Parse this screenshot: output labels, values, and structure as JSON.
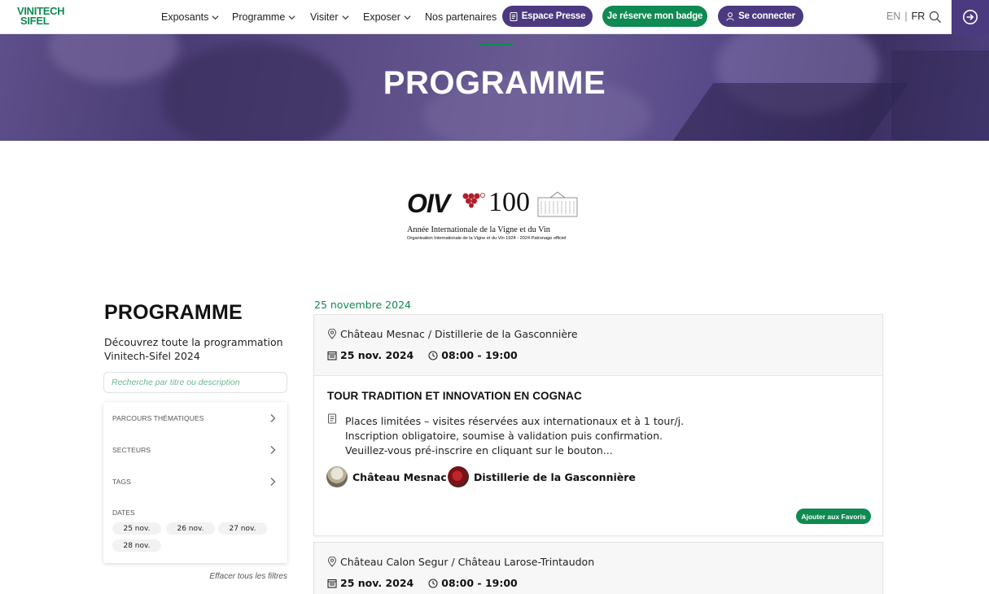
{
  "header": {
    "logo_line1": "VINITECH",
    "logo_line2": "SIFEL",
    "nav": [
      {
        "label": "Exposants",
        "has_dropdown": true
      },
      {
        "label": "Programme",
        "has_dropdown": true
      },
      {
        "label": "Visiter",
        "has_dropdown": true
      },
      {
        "label": "Exposer",
        "has_dropdown": true
      },
      {
        "label": "Nos partenaires",
        "has_dropdown": false
      }
    ],
    "press_button": "Espace Presse",
    "badge_button": "Je réserve mon badge",
    "login_button": "Se connecter",
    "lang_en": "EN",
    "lang_sep": "|",
    "lang_fr": "FR",
    "icons": {
      "press": "document-icon",
      "login": "user-icon",
      "search": "search-icon",
      "side": "login-arrow-icon"
    }
  },
  "hero": {
    "title": "PROGRAMME"
  },
  "oiv_logo": {
    "brand": "OIV",
    "number": "100",
    "line1": "Année Internationale de la Vigne et du Vin",
    "line2": "Organisation Internationale de la Vigne et du Vin 1924 - 2024 Patronage officiel"
  },
  "sidebar": {
    "title": "PROGRAMME",
    "description": "Découvrez toute la programmation Vinitech-Sifel 2024",
    "search_placeholder": "Recherche par titre ou description",
    "filters": [
      {
        "label": "PARCOURS THÉMATIQUES"
      },
      {
        "label": "SECTEURS"
      },
      {
        "label": "TAGS"
      }
    ],
    "dates_label": "DATES",
    "dates": [
      "25 nov.",
      "26 nov.",
      "27 nov.",
      "28 nov."
    ],
    "clear_filters": "Effacer tous les filtres"
  },
  "main": {
    "date_heading": "25 novembre 2024",
    "events": [
      {
        "location": "Château Mesnac / Distillerie de la Gasconnière",
        "date": "25 nov. 2024",
        "time": "08:00 - 19:00",
        "title": "TOUR TRADITION ET INNOVATION EN COGNAC",
        "description_lines": [
          "Places limitées – visites réservées aux internationaux et à 1 tour/j.",
          "Inscription obligatoire, soumise à validation puis confirmation.",
          "Veuillez-vous pré-inscrire en cliquant sur le bouton..."
        ],
        "exhibitors": [
          "Château Mesnac",
          "Distillerie de la Gasconnière"
        ],
        "favorite_button": "Ajouter aux Favoris"
      },
      {
        "location": "Château Calon Segur / Château Larose-Trintaudon",
        "date": "25 nov. 2024",
        "time": "08:00 - 19:00"
      }
    ]
  },
  "colors": {
    "purple": "#4b3a80",
    "green": "#0f8a52",
    "card_top": "#f7f7f7"
  }
}
